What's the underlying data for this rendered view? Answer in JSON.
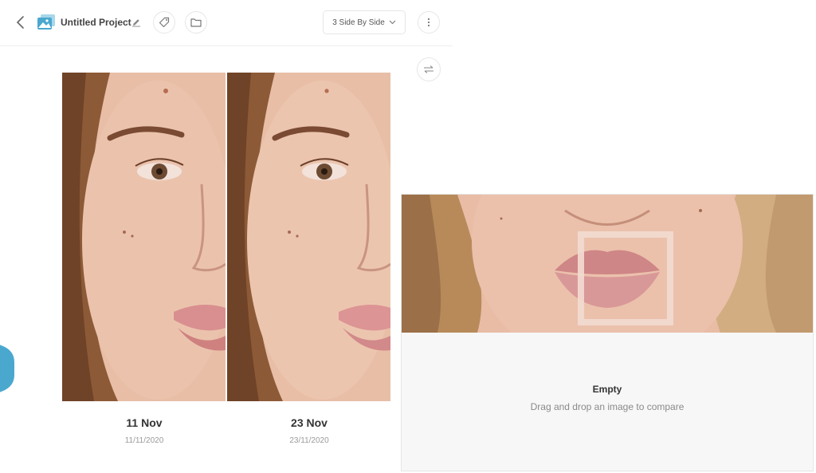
{
  "header": {
    "title": "Untitled Project",
    "layout_label": "3 Side By Side"
  },
  "photos": [
    {
      "date": "11 Nov",
      "subdate": "11/11/2020"
    },
    {
      "date": "23 Nov",
      "subdate": "23/11/2020"
    }
  ],
  "empty": {
    "title": "Empty",
    "subtitle": "Drag and drop an image to compare"
  },
  "colors": {
    "accent": "#4aa8cf",
    "skin": "#e7b9a1",
    "hair": "#8b5a35",
    "lips": "#d88d8e"
  }
}
